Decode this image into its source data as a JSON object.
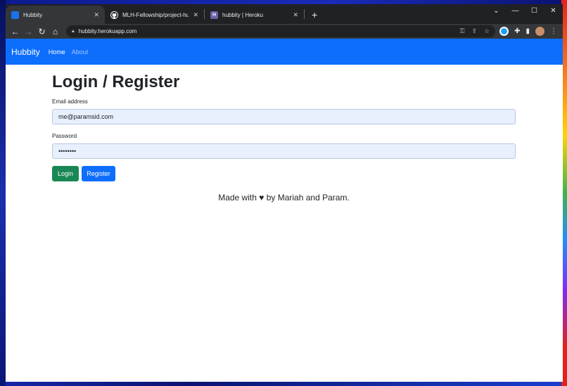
{
  "browser": {
    "tabs": [
      {
        "title": "Hubbity",
        "favicon": "hubbity-favicon",
        "favicon_color": "#1a73e8"
      },
      {
        "title": "MLH-Fellowship/project-hubbity",
        "favicon": "github-icon",
        "favicon_color": "#ffffff"
      },
      {
        "title": "hubbity | Heroku",
        "favicon": "heroku-icon",
        "favicon_color": "#6762a6"
      }
    ],
    "new_tab_label": "+",
    "url": "hubbity.herokuapp.com"
  },
  "app": {
    "brand": "Hubbity",
    "nav": [
      {
        "label": "Home",
        "active": true
      },
      {
        "label": "About",
        "active": false
      }
    ]
  },
  "page": {
    "title": "Login / Register",
    "email_label": "Email address",
    "email_value": "me@paramsid.com",
    "password_label": "Password",
    "password_value": "••••••••",
    "login_label": "Login",
    "register_label": "Register",
    "footer_prefix": "Made with",
    "footer_suffix": "by Mariah and Param."
  },
  "colors": {
    "primary": "#0d6efd",
    "success": "#198754",
    "input_bg": "#e8f0fe"
  }
}
